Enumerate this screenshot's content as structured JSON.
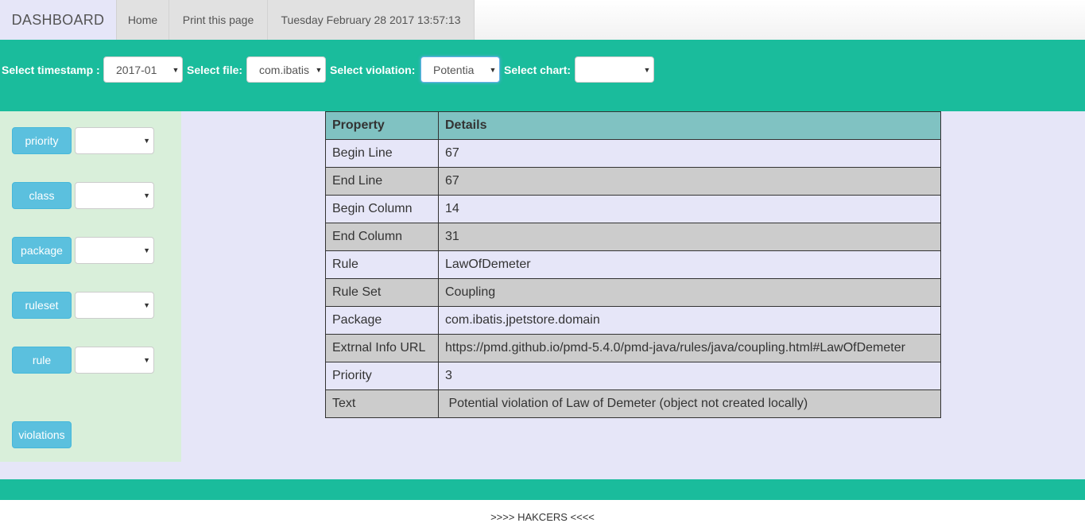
{
  "navbar": {
    "brand": "DASHBOARD",
    "home": "Home",
    "print": "Print this page",
    "datetime": "Tuesday February 28 2017 13:57:13"
  },
  "filters": {
    "timestamp_label": "Select timestamp :",
    "timestamp_value": "2017-01",
    "file_label": "Select file:",
    "file_value": "com.ibatis",
    "violation_label": "Select violation:",
    "violation_value": "Potentia",
    "chart_label": "Select chart:",
    "chart_value": ""
  },
  "sidebar": {
    "buttons": [
      {
        "label": "priority",
        "select_value": ""
      },
      {
        "label": "class",
        "select_value": ""
      },
      {
        "label": "package",
        "select_value": ""
      },
      {
        "label": "ruleset",
        "select_value": ""
      },
      {
        "label": "rule",
        "select_value": ""
      }
    ],
    "violations_label": "violations"
  },
  "table": {
    "headers": [
      "Property",
      "Details"
    ],
    "rows": [
      [
        "Begin Line",
        "67"
      ],
      [
        "End Line",
        "67"
      ],
      [
        "Begin Column",
        "14"
      ],
      [
        "End Column",
        "31"
      ],
      [
        "Rule",
        "LawOfDemeter"
      ],
      [
        "Rule Set",
        "Coupling"
      ],
      [
        "Package",
        "com.ibatis.jpetstore.domain"
      ],
      [
        "Extrnal Info URL",
        "https://pmd.github.io/pmd-5.4.0/pmd-java/rules/java/coupling.html#LawOfDemeter"
      ],
      [
        "Priority",
        "3"
      ],
      [
        "Text",
        " Potential violation of Law of Demeter (object not created locally)"
      ]
    ]
  },
  "footer": {
    "text": ">>>> HAKCERS <<<<"
  },
  "colors": {
    "accent": "#1abc9c",
    "sidebar_bg": "#d9efda",
    "main_bg": "#e6e6f8",
    "button_info": "#5bc0de",
    "table_header": "#80c2c2"
  }
}
